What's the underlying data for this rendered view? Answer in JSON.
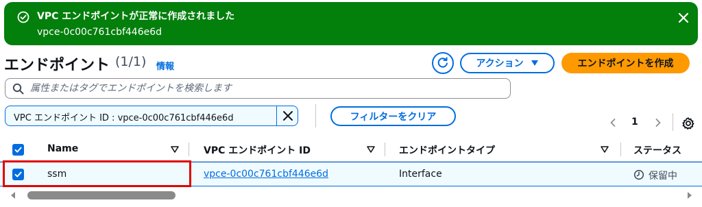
{
  "banner": {
    "title": "VPC エンドポイントが正常に作成されました",
    "subtitle": "vpce-0c00c761cbf446e6d",
    "icon": "check-circle-icon",
    "close_icon": "close-icon",
    "color": "#037f0c"
  },
  "header": {
    "title": "エンドポイント",
    "count": "(1/1)",
    "info_link": "情報",
    "refresh_icon": "refresh-icon",
    "actions_label": "アクション",
    "actions_icon": "caret-down-icon",
    "create_label": "エンドポイントを作成"
  },
  "search": {
    "placeholder": "属性またはタグでエンドポイントを検索します",
    "value": "",
    "icon": "search-icon"
  },
  "filter": {
    "token_label": "VPC エンドポイント ID : vpce-0c00c761cbf446e6d",
    "clear_label": "フィルターをクリア"
  },
  "pagination": {
    "current_page": "1",
    "prev_icon": "chevron-left-icon",
    "next_icon": "chevron-right-icon",
    "settings_icon": "gear-icon"
  },
  "table": {
    "columns": [
      "Name",
      "VPC エンドポイント ID",
      "エンドポイントタイプ",
      "ステータス"
    ],
    "rows": [
      {
        "selected": true,
        "name": "ssm",
        "endpoint_id": "vpce-0c00c761cbf446e6d",
        "endpoint_type": "Interface",
        "status": "保留中",
        "status_icon": "pending-clock-icon"
      }
    ],
    "header_checked": true
  },
  "colors": {
    "accent": "#006ce0",
    "primary_button": "#ff9900",
    "selected_row": "#f0fbff",
    "highlight_box": "#e00000"
  }
}
